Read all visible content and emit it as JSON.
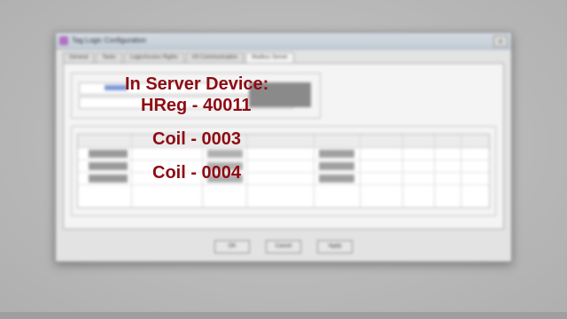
{
  "dialog": {
    "title": "Tag Logic Configuration",
    "close_glyph": "x",
    "tabs": [
      "General",
      "Tasks",
      "Logic/Access Rights",
      "I/O Communication",
      "Modbus Server"
    ],
    "active_tab_index": 4,
    "buttons": {
      "ok": "OK",
      "cancel": "Cancel",
      "apply": "Apply"
    }
  },
  "overlay": {
    "line1": "In Server Device:",
    "line2": "HReg - 40011",
    "line3": "Coil - 0003",
    "line4": "Coil - 0004"
  },
  "colors": {
    "overlay_text": "#8e0b12",
    "background": "#b8b8b8"
  },
  "icons": [
    "app-icon",
    "close-icon"
  ]
}
